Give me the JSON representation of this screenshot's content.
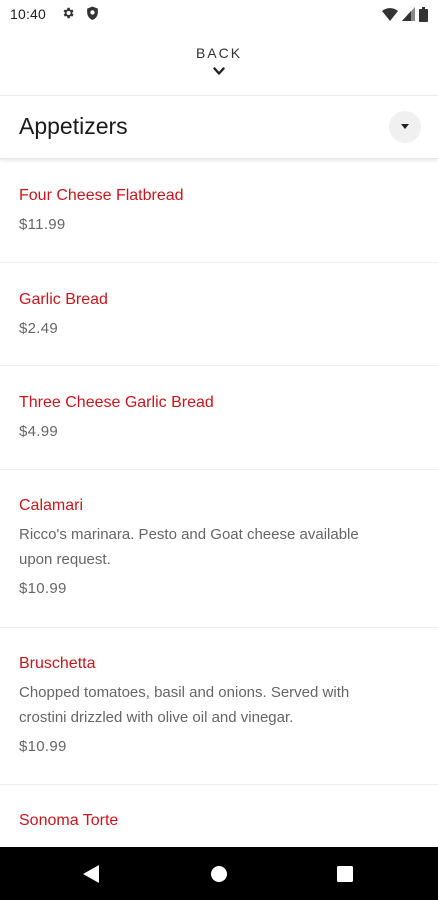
{
  "status_bar": {
    "time": "10:40",
    "icons": [
      "gear-icon",
      "shield-icon",
      "wifi-icon",
      "cell-signal-icon",
      "battery-icon"
    ]
  },
  "header": {
    "back_label": "BACK"
  },
  "category": {
    "title": "Appetizers"
  },
  "menu": {
    "items": [
      {
        "name": "Four Cheese Flatbread",
        "price": "$11.99"
      },
      {
        "name": "Garlic Bread",
        "price": "$2.49"
      },
      {
        "name": "Three Cheese Garlic Bread",
        "price": "$4.99"
      },
      {
        "name": "Calamari",
        "desc_line1": "Ricco's marinara. Pesto and Goat cheese available",
        "desc_line2": "upon request.",
        "price": "$10.99"
      },
      {
        "name": "Bruschetta",
        "desc_line1": "Chopped tomatoes, basil and onions. Served with",
        "desc_line2": "crostini drizzled with olive oil and vinegar.",
        "price": "$10.99"
      },
      {
        "name": "Sonoma Torte"
      }
    ]
  },
  "colors": {
    "accent": "#c8161d",
    "text_primary": "#1a1a1a",
    "text_secondary": "#666666",
    "nav_bar": "#000000"
  }
}
